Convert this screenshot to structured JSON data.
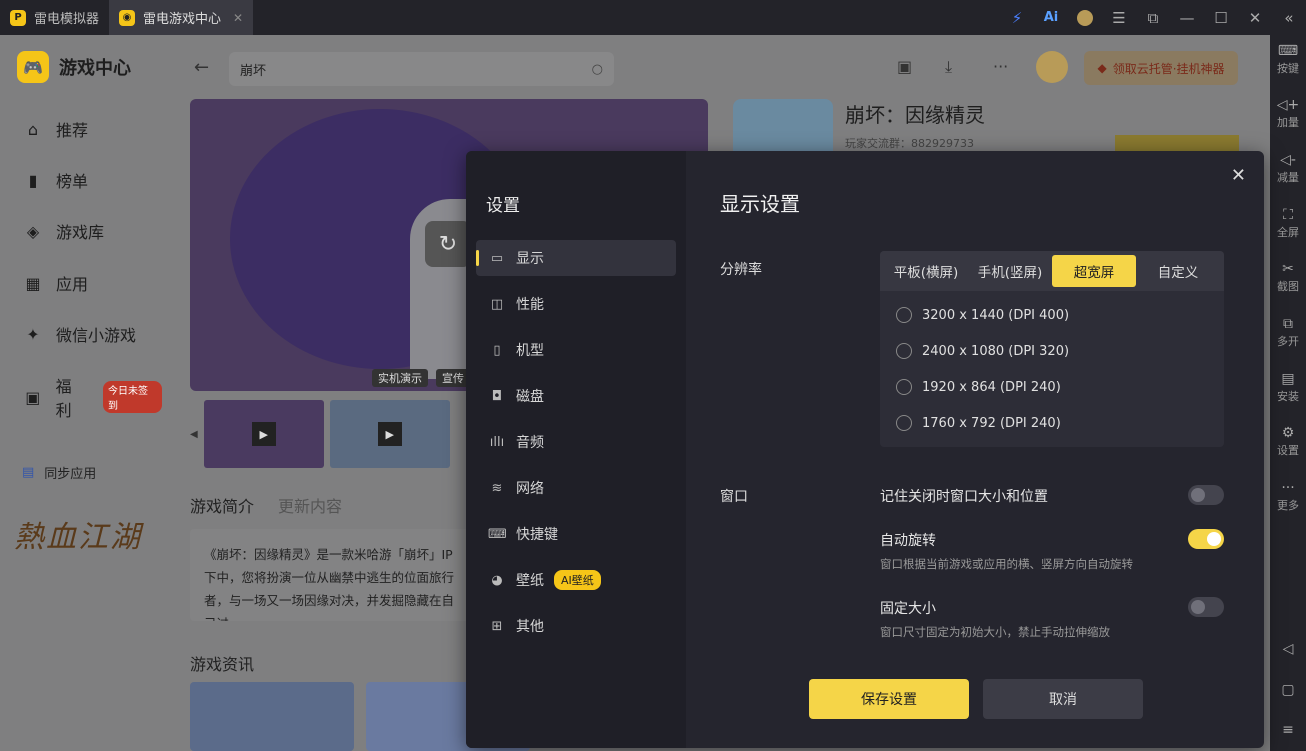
{
  "titlebar": {
    "tabs": [
      {
        "label": "雷电模拟器"
      },
      {
        "label": "雷电游戏中心"
      }
    ],
    "ai_label": "Ai"
  },
  "right_toolbar": [
    {
      "label": "按键",
      "icon": "keyboard-icon"
    },
    {
      "label": "加量",
      "icon": "volume-up-icon"
    },
    {
      "label": "减量",
      "icon": "volume-down-icon"
    },
    {
      "label": "全屏",
      "icon": "fullscreen-icon"
    },
    {
      "label": "截图",
      "icon": "scissors-icon"
    },
    {
      "label": "多开",
      "icon": "multi-instance-icon"
    },
    {
      "label": "安装",
      "icon": "install-icon"
    },
    {
      "label": "设置",
      "icon": "gear-icon"
    },
    {
      "label": "更多",
      "icon": "more-icon"
    }
  ],
  "app": {
    "brand": "游戏中心",
    "nav": [
      {
        "label": "推荐"
      },
      {
        "label": "榜单"
      },
      {
        "label": "游戏库"
      },
      {
        "label": "应用"
      },
      {
        "label": "微信小游戏"
      },
      {
        "label": "福利",
        "badge": "今日未签到"
      }
    ],
    "sync_label": "同步应用",
    "search_value": "崩坏",
    "promo": "领取云托管·挂机神器",
    "hero_tags": [
      "实机演示",
      "宣传"
    ],
    "game_title": "崩坏：因缘精灵",
    "game_sub": "玩家交流群：882929733",
    "tabs": [
      "游戏简介",
      "更新内容"
    ],
    "description": "《崩坏：因缘精灵》是一款米哈游「崩坏」IP下中，您将扮演一位从幽禁中逃生的位面旅行者，与一场又一场因缘对决，并发掘隐藏在自己过...",
    "news_title": "游戏资讯"
  },
  "settings": {
    "sidebar_title": "设置",
    "sections": [
      {
        "label": "显示",
        "icon": "monitor-icon"
      },
      {
        "label": "性能",
        "icon": "performance-icon"
      },
      {
        "label": "机型",
        "icon": "phone-icon"
      },
      {
        "label": "磁盘",
        "icon": "disk-icon"
      },
      {
        "label": "音频",
        "icon": "audio-icon"
      },
      {
        "label": "网络",
        "icon": "wifi-icon"
      },
      {
        "label": "快捷键",
        "icon": "keyboard-icon"
      },
      {
        "label": "壁纸",
        "icon": "palette-icon",
        "tag": "AI壁纸"
      },
      {
        "label": "其他",
        "icon": "grid-icon"
      }
    ],
    "title": "显示设置",
    "resolution_label": "分辨率",
    "resolution_tabs": [
      "平板(横屏)",
      "手机(竖屏)",
      "超宽屏",
      "自定义"
    ],
    "resolution_selected": "超宽屏",
    "resolutions": [
      "3200 x 1440  (DPI 400)",
      "2400 x 1080  (DPI 320)",
      "1920 x 864  (DPI 240)",
      "1760 x 792  (DPI 240)"
    ],
    "window_label": "窗口",
    "options": [
      {
        "label": "记住关闭时窗口大小和位置",
        "desc": "",
        "on": false
      },
      {
        "label": "自动旋转",
        "desc": "窗口根据当前游戏或应用的横、竖屏方向自动旋转",
        "on": true
      },
      {
        "label": "固定大小",
        "desc": "窗口尺寸固定为初始大小，禁止手动拉伸缩放",
        "on": false
      }
    ],
    "save_label": "保存设置",
    "cancel_label": "取消"
  }
}
